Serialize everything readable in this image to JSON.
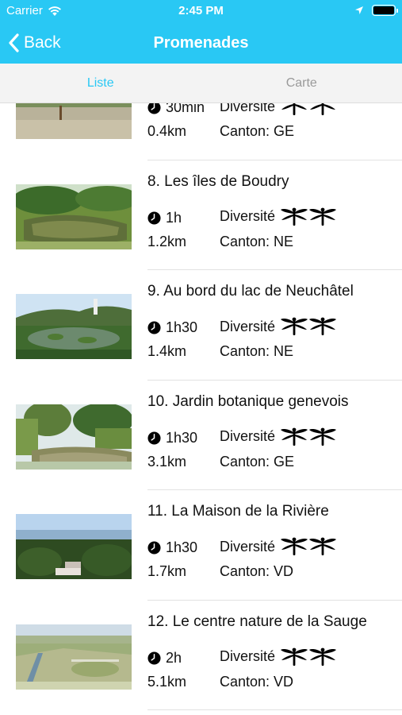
{
  "status_bar": {
    "carrier": "Carrier",
    "time": "2:45 PM",
    "icons": [
      "wifi-icon",
      "location-icon",
      "battery-icon"
    ]
  },
  "nav": {
    "back_label": "Back",
    "title": "Promenades"
  },
  "tabs": [
    {
      "label": "Liste",
      "active": true
    },
    {
      "label": "Carte",
      "active": false
    }
  ],
  "walks": [
    {
      "title": "",
      "duration": "30min",
      "distance": "0.4km",
      "diversity_label": "Diversité",
      "canton": "Canton: GE",
      "scene": "garden"
    },
    {
      "title": "8. Les îles de Boudry",
      "duration": "1h",
      "distance": "1.2km",
      "diversity_label": "Diversité",
      "canton": "Canton: NE",
      "scene": "pond"
    },
    {
      "title": "9. Au bord du lac de Neuchâtel",
      "duration": "1h30",
      "distance": "1.4km",
      "diversity_label": "Diversité",
      "canton": "Canton: NE",
      "scene": "lilypond"
    },
    {
      "title": "10. Jardin botanique genevois",
      "duration": "1h30",
      "distance": "3.1km",
      "diversity_label": "Diversité",
      "canton": "Canton: GE",
      "scene": "botanic"
    },
    {
      "title": "11. La Maison de la Rivière",
      "duration": "1h30",
      "distance": "1.7km",
      "diversity_label": "Diversité",
      "canton": "Canton: VD",
      "scene": "aerial"
    },
    {
      "title": "12. Le centre nature de la Sauge",
      "duration": "2h",
      "distance": "5.1km",
      "diversity_label": "Diversité",
      "canton": "Canton: VD",
      "scene": "wetland"
    }
  ],
  "colors": {
    "accent": "#29c8f4",
    "tab_inactive": "#9a9a9a",
    "separator": "#e2e2e2"
  }
}
